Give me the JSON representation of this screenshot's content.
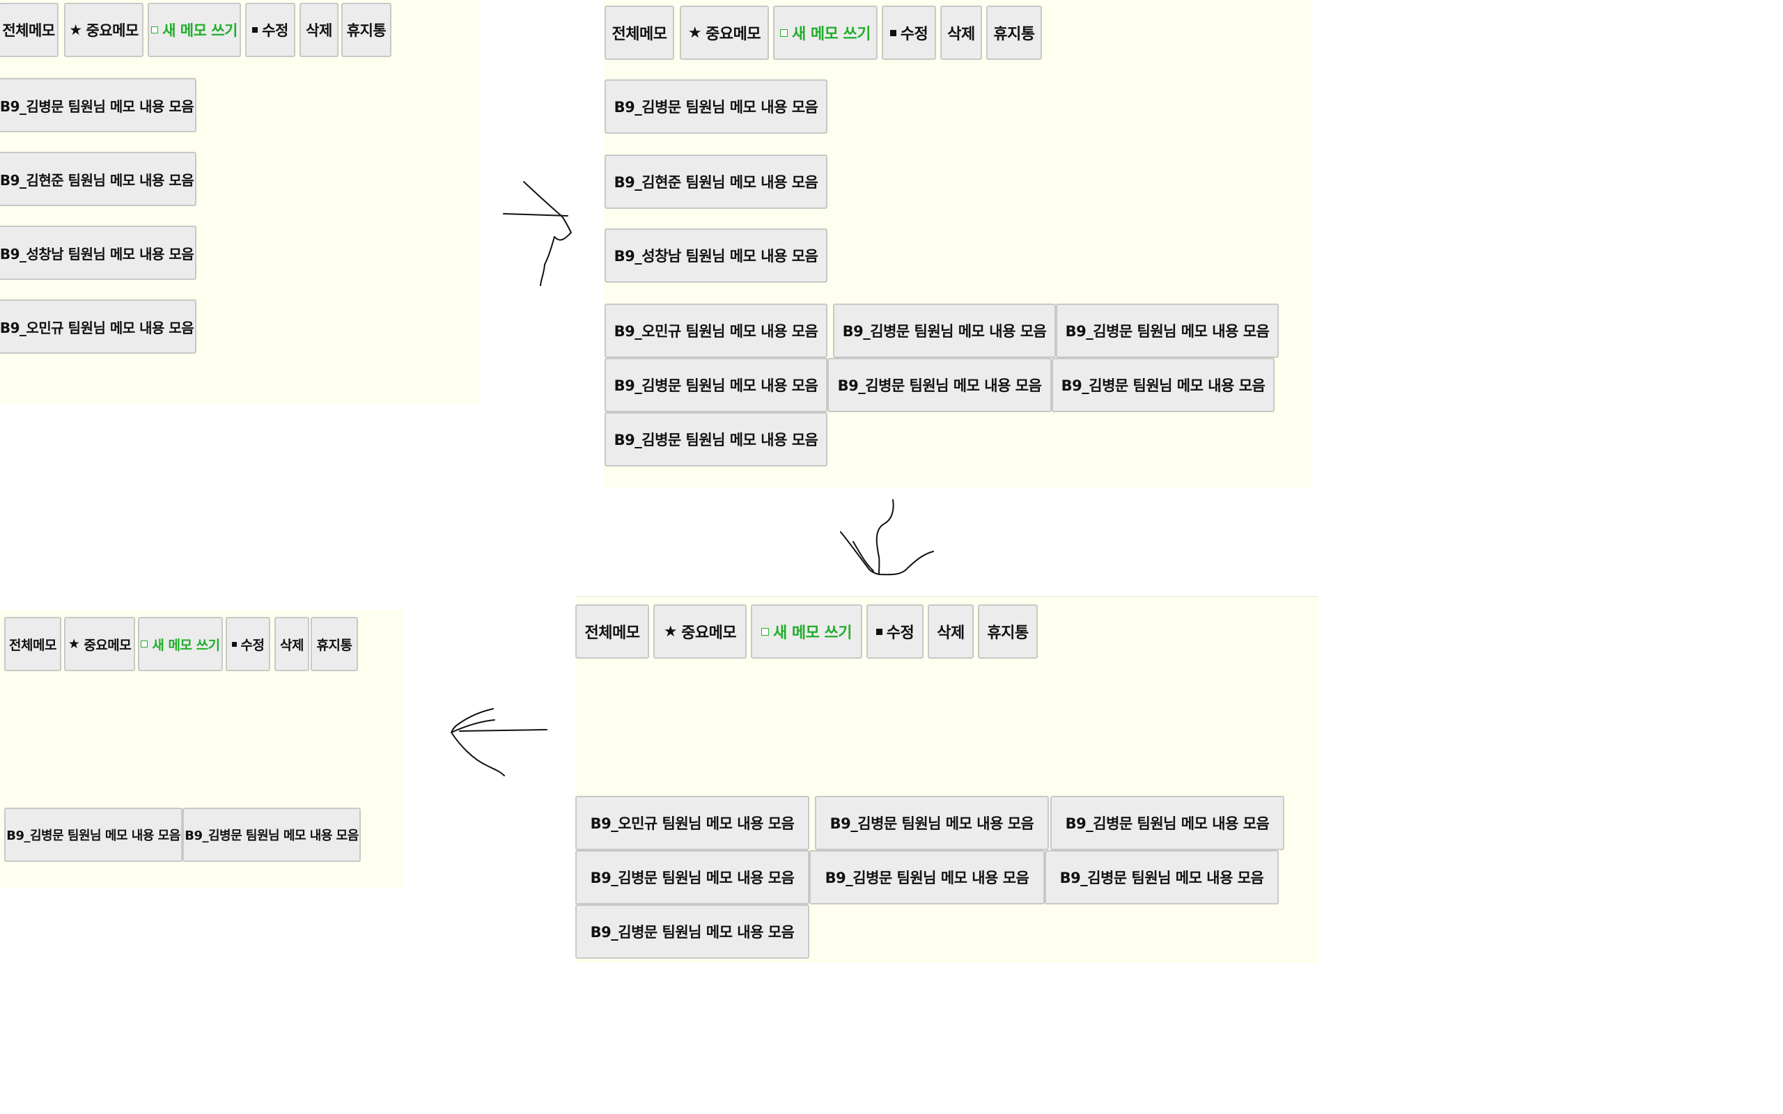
{
  "toolbar": {
    "all_memo": "전체메모",
    "important": "중요메모",
    "new_memo": "새 메모 쓰기",
    "edit": "수정",
    "delete": "삭제",
    "trash": "휴지통",
    "star_glyph": "★"
  },
  "memos": {
    "kim_bm": "B9_김병문 팀원님 메모 내용 모음",
    "kim_hj": "B9_김현준 팀원님 메모 내용 모음",
    "sung_cn": "B9_성창남 팀원님 메모 내용 모음",
    "oh_mg": "B9_오민규 팀원님 메모 내용 모음"
  },
  "colors": {
    "panel_bg": "#ffffef",
    "button_bg": "#ececec",
    "accent_green": "#1fae2a"
  },
  "icons": [
    "star-icon",
    "new-note-square-icon",
    "edit-square-icon",
    "hand-drawn-arrow-icon"
  ]
}
